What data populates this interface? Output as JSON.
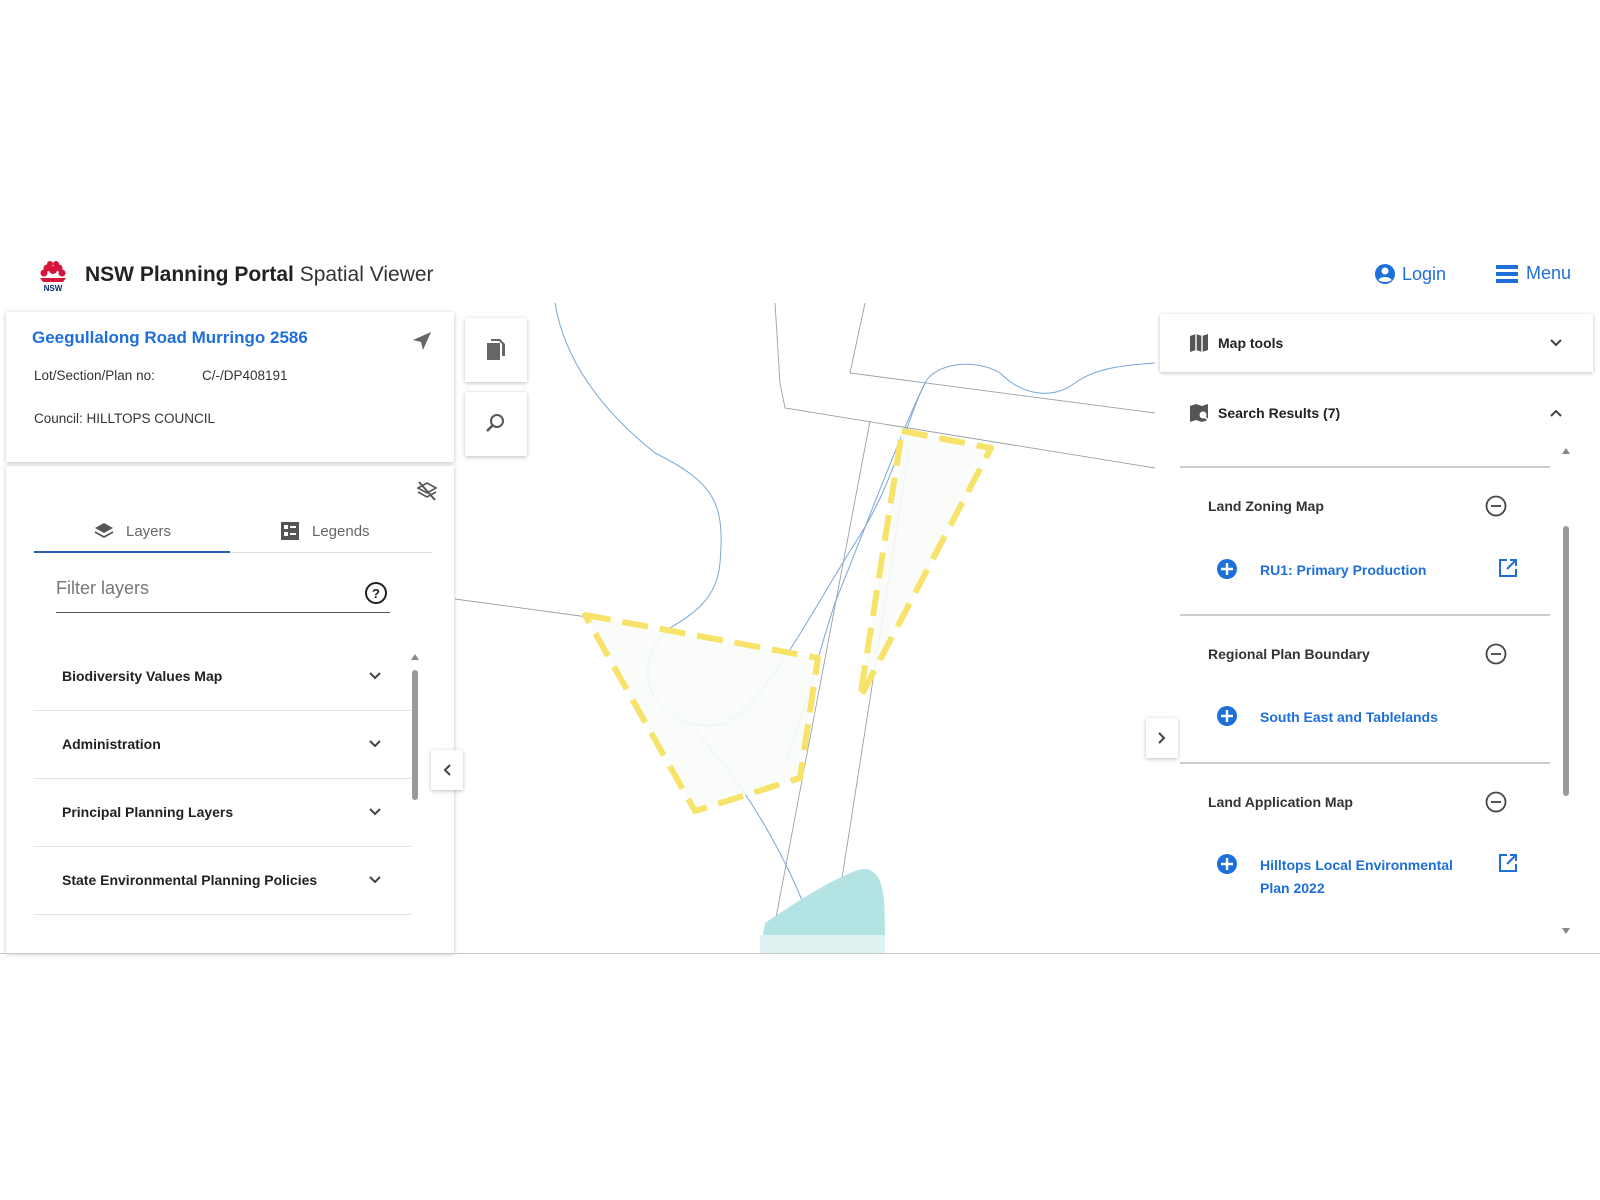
{
  "header": {
    "brand_bold": "NSW Planning Portal",
    "brand_light": "Spatial Viewer",
    "login_label": "Login",
    "menu_label": "Menu"
  },
  "address": {
    "title": "Geegullalong Road Murringo 2586",
    "lot_label": "Lot/Section/Plan no:",
    "lot_value": "C/-/DP408191",
    "council": "Council: HILLTOPS COUNCIL"
  },
  "layers_panel": {
    "tabs": [
      {
        "label": "Layers",
        "active": true
      },
      {
        "label": "Legends",
        "active": false
      }
    ],
    "filter_placeholder": "Filter layers",
    "items": [
      {
        "label": "Biodiversity Values Map"
      },
      {
        "label": "Administration"
      },
      {
        "label": "Principal Planning Layers"
      },
      {
        "label": "State Environmental Planning Policies"
      }
    ]
  },
  "right_panel": {
    "map_tools_label": "Map tools",
    "search_results_label": "Search Results (7)",
    "results": [
      {
        "heading": "Land Zoning Map",
        "link": "RU1: Primary Production",
        "external": true
      },
      {
        "heading": "Regional Plan Boundary",
        "link": "South East and Tablelands",
        "external": false
      },
      {
        "heading": "Land Application Map",
        "link": "Hilltops Local Environmental Plan 2022",
        "external": true
      }
    ]
  },
  "colors": {
    "accent": "#1e6fd9",
    "selection": "#f7e36a",
    "water": "#b4e3e3",
    "tab_underline": "#2c5cb8"
  }
}
